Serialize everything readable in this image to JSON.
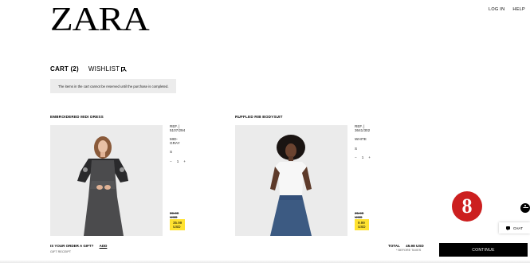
{
  "header": {
    "logo": "ZARA",
    "links": [
      "LOG IN",
      "HELP"
    ]
  },
  "tabs": {
    "cart": "CART (2)",
    "wishlist": "WISHLIST"
  },
  "notice": "The items in the cart cannot be reserved until the purchase is completed.",
  "products": [
    {
      "title": "EMBROIDERED MIDI DRESS",
      "ref": "REF. | 5107/294",
      "color": "MID-GRAY",
      "size": "S",
      "qty": "1",
      "old_price": "89.00 USD",
      "new_price": "35.99 USD"
    },
    {
      "title": "RUFFLED RIB BODYSUIT",
      "ref": "REF. | 3641/302",
      "color": "WHITE",
      "size": "S",
      "qty": "1",
      "old_price": "25.90 USD",
      "new_price": "9.99 USD"
    }
  ],
  "gift": {
    "question": "IS YOUR ORDER A GIFT?",
    "add": "ADD",
    "receipt": "GIFT RECEIPT"
  },
  "total": {
    "label": "TOTAL",
    "value": "45.98 USD",
    "note": "* BEFORE TAXES"
  },
  "continue_label": "CONTINUE",
  "badge": "8",
  "chat_label": "CHAT",
  "colors": {
    "price_highlight": "#ffe230",
    "badge": "#cc1f1f"
  }
}
